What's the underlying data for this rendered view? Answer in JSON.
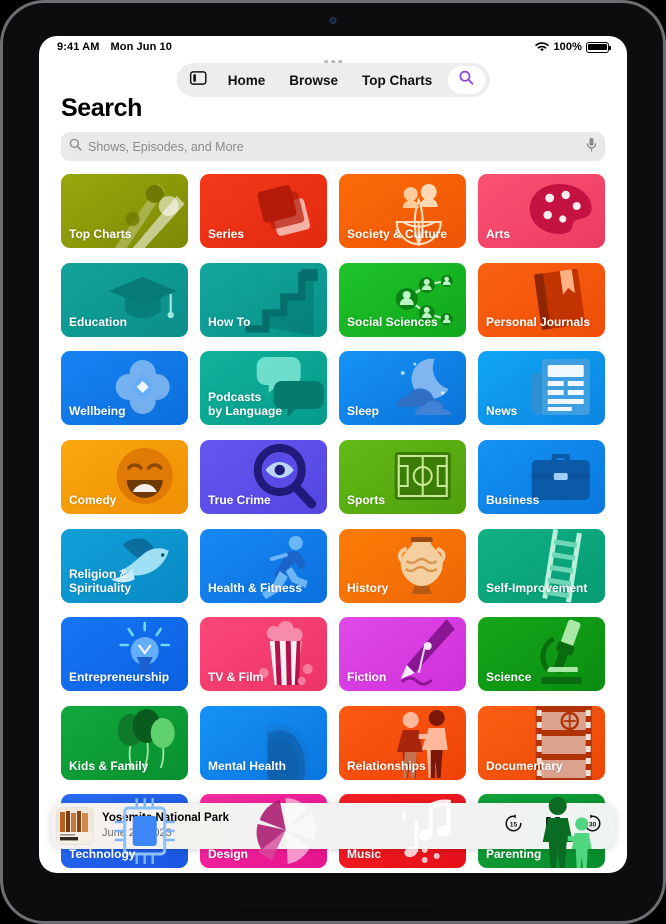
{
  "status_bar": {
    "time": "9:41 AM",
    "date": "Mon Jun 10",
    "wifi_icon": "wifi-icon",
    "battery_percent": "100%",
    "battery_icon": "battery-full-icon"
  },
  "nav": {
    "sidebar_icon": "sidebar-toggle-icon",
    "tabs": [
      {
        "label": "Home",
        "name": "tab-home"
      },
      {
        "label": "Browse",
        "name": "tab-browse"
      },
      {
        "label": "Top Charts",
        "name": "tab-top-charts"
      }
    ],
    "search_icon": "search-icon",
    "accent": "#8a44d4"
  },
  "header": {
    "title": "Search"
  },
  "search": {
    "placeholder": "Shows, Episodes, and More",
    "value": "",
    "leading_icon": "search-icon",
    "mic_icon": "microphone-icon"
  },
  "categories": [
    {
      "label": "Top Charts",
      "art": "chart-beams",
      "c1": "#9aa70c",
      "c2": "#7d8a05",
      "ink": "#6e7a04"
    },
    {
      "label": "Series",
      "art": "stacked-cards",
      "c1": "#f5381a",
      "c2": "#e12a10",
      "ink": "#b41a08"
    },
    {
      "label": "Society & Culture",
      "art": "globe-people",
      "c1": "#fc6b08",
      "c2": "#ef5505",
      "ink": "#ffcb9a"
    },
    {
      "label": "Arts",
      "art": "palette",
      "c1": "#fb5273",
      "c2": "#ec3b62",
      "ink": "#c41341"
    },
    {
      "label": "Education",
      "art": "graduation-cap",
      "c1": "#12a39b",
      "c2": "#0b8e8a",
      "ink": "#067b78"
    },
    {
      "label": "How To",
      "art": "stairs",
      "c1": "#12a79c",
      "c2": "#089289",
      "ink": "#046f6b"
    },
    {
      "label": "Social Sciences",
      "art": "network-people",
      "c1": "#1fc42a",
      "c2": "#10a71c",
      "ink": "#0a8315"
    },
    {
      "label": "Personal Journals",
      "art": "book-bookmark",
      "c1": "#fb6212",
      "c2": "#ee4d07",
      "ink": "#c23300"
    },
    {
      "label": "Wellbeing",
      "art": "flower-diamond",
      "c1": "#1683f2",
      "c2": "#0b6fdc",
      "ink": "#68aef5"
    },
    {
      "label": "Podcasts\nby Language",
      "art": "speech-bubbles",
      "c1": "#11b29c",
      "c2": "#059b8a",
      "ink": "#057b6e"
    },
    {
      "label": "Sleep",
      "art": "moon-clouds",
      "c1": "#1693f5",
      "c2": "#0a72d8",
      "ink": "#2f6fc4"
    },
    {
      "label": "News",
      "art": "newspaper",
      "c1": "#11a5f5",
      "c2": "#0b85e2",
      "ink": "#3e9fe0"
    },
    {
      "label": "Comedy",
      "art": "smiley-face",
      "c1": "#fba80d",
      "c2": "#ef8f05",
      "ink": "#e07a04"
    },
    {
      "label": "True Crime",
      "art": "magnifier-eye",
      "c1": "#6457f0",
      "c2": "#5346e2",
      "ink": "#221a7a"
    },
    {
      "label": "Sports",
      "art": "soccer-pitch",
      "c1": "#62ba16",
      "c2": "#4fa00c",
      "ink": "#3b7c06"
    },
    {
      "label": "Business",
      "art": "briefcase",
      "c1": "#1492f4",
      "c2": "#0a78de",
      "ink": "#0a5aa8"
    },
    {
      "label": "Religion &\nSpirituality",
      "art": "dove",
      "c1": "#11a0d8",
      "c2": "#0889c4",
      "ink": "#0a6e9e"
    },
    {
      "label": "Health & Fitness",
      "art": "runner",
      "c1": "#1789f4",
      "c2": "#0b70de",
      "ink": "#6cb6f7"
    },
    {
      "label": "History",
      "art": "amphora",
      "c1": "#fb7d07",
      "c2": "#ef6605",
      "ink": "#f3b97a"
    },
    {
      "label": "Self-Improvement",
      "art": "ladder",
      "c1": "#11b083",
      "c2": "#069b74",
      "ink": "#6fd6b6"
    },
    {
      "label": "Entrepreneurship",
      "art": "lightbulb",
      "c1": "#1576f4",
      "c2": "#0b60e0",
      "ink": "#63aef8"
    },
    {
      "label": "TV & Film",
      "art": "popcorn",
      "c1": "#fb4878",
      "c2": "#ec3365",
      "ink": "#f79ab4"
    },
    {
      "label": "Fiction",
      "art": "fountain-pen",
      "c1": "#e04ae8",
      "c2": "#cf2fd9",
      "ink": "#8b1694"
    },
    {
      "label": "Science",
      "art": "microscope",
      "c1": "#15a61b",
      "c2": "#0a8d10",
      "ink": "#0a6b0e"
    },
    {
      "label": "Kids & Family",
      "art": "balloons",
      "c1": "#12a83c",
      "c2": "#089030",
      "ink": "#066e22"
    },
    {
      "label": "Mental Health",
      "art": "head-profile",
      "c1": "#1592f5",
      "c2": "#0a76e0",
      "ink": "#1066b8"
    },
    {
      "label": "Relationships",
      "art": "two-people",
      "c1": "#fb5a12",
      "c2": "#ef4306",
      "ink": "#f49b76"
    },
    {
      "label": "Documentary",
      "art": "film-strip",
      "c1": "#fb5f13",
      "c2": "#ec4707",
      "ink": "#b03305"
    },
    {
      "label": "Technology",
      "art": "microchip",
      "c1": "#2a6bf2",
      "c2": "#1a56e2",
      "ink": "#5f9bfa"
    },
    {
      "label": "Design",
      "art": "pinwheel",
      "c1": "#f72ba2",
      "c2": "#e6148e",
      "ink": "#f9a0d2"
    },
    {
      "label": "Music",
      "art": "music-notes",
      "c1": "#f71f26",
      "c2": "#e40f18",
      "ink": "#f97a7e"
    },
    {
      "label": "Parenting",
      "art": "parent-child",
      "c1": "#13a43a",
      "c2": "#088c2c",
      "ink": "#066d1f"
    }
  ],
  "now_playing": {
    "artwork_title": "Field Trip",
    "title": "Yosemite National Park",
    "subtitle": "June 28, 2023",
    "skip_back_label": "15",
    "skip_back_icon": "rewind-15-icon",
    "play_pause_icon": "pause-icon",
    "skip_forward_label": "30",
    "skip_forward_icon": "forward-30-icon"
  }
}
